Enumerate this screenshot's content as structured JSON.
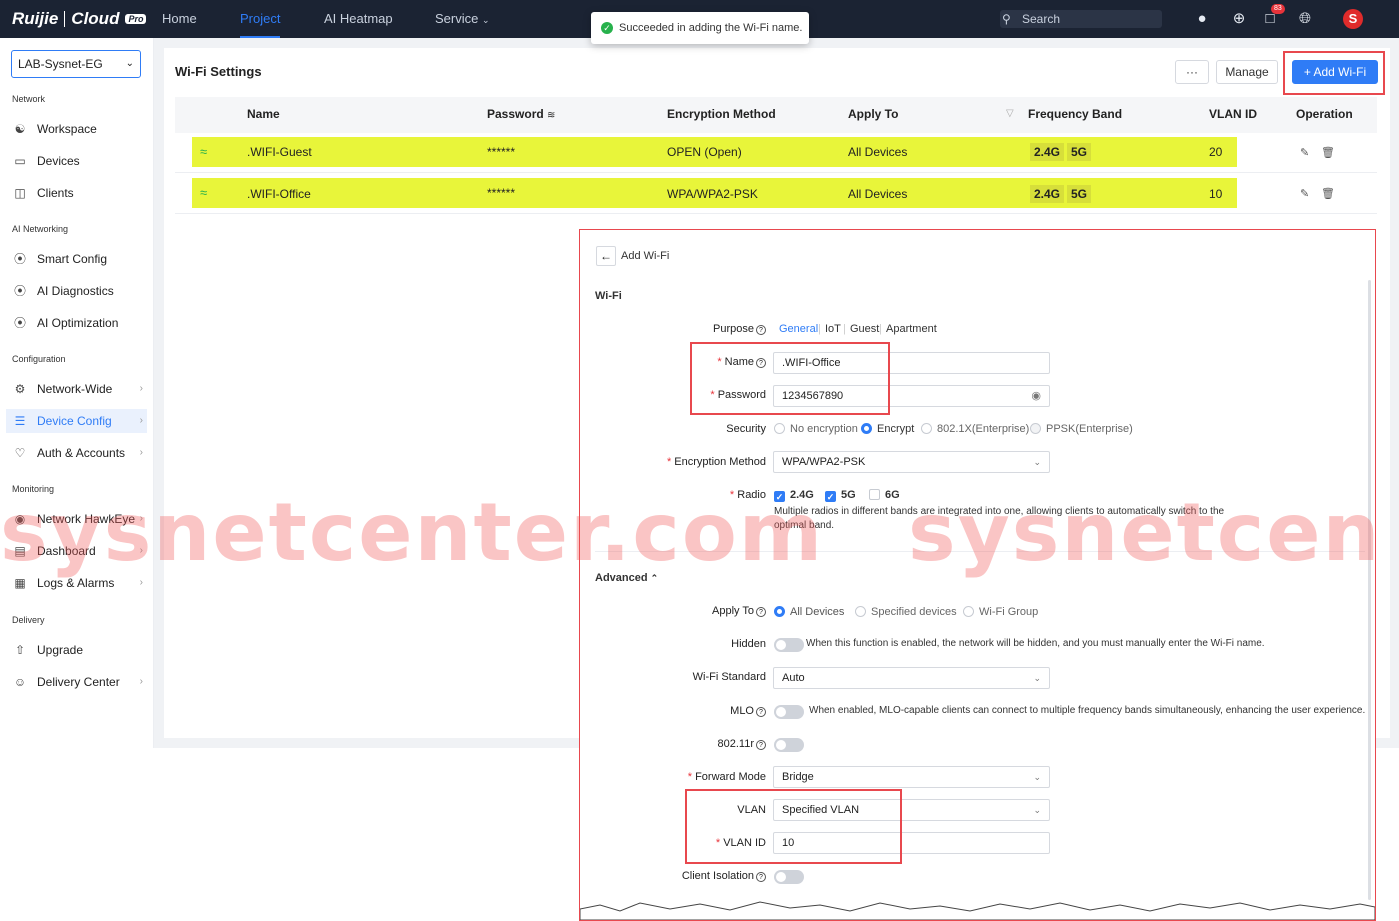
{
  "topbar": {
    "brand": "Ruijie",
    "product": "Cloud",
    "badge": "Pro",
    "nav": [
      "Home",
      "Project",
      "AI Heatmap",
      "Service"
    ],
    "active_nav": "Project",
    "search_placeholder": "Search",
    "notifications": "83",
    "avatar_letter": "S"
  },
  "toast": {
    "text": "Succeeded in adding the Wi-Fi name."
  },
  "sidebar": {
    "project": "LAB-Sysnet-EG",
    "sections": [
      {
        "title": "Network",
        "items": [
          "Workspace",
          "Devices",
          "Clients"
        ]
      },
      {
        "title": "AI Networking",
        "items": [
          "Smart Config",
          "AI Diagnostics",
          "AI Optimization"
        ]
      },
      {
        "title": "Configuration",
        "items": [
          "Network-Wide",
          "Device Config",
          "Auth & Accounts"
        ]
      },
      {
        "title": "Monitoring",
        "items": [
          "Network HawkEye",
          "Dashboard",
          "Logs & Alarms"
        ]
      },
      {
        "title": "Delivery",
        "items": [
          "Upgrade",
          "Delivery Center"
        ]
      }
    ],
    "active_item": "Device Config"
  },
  "main": {
    "title": "Wi-Fi Settings",
    "more_label": "···",
    "manage_label": "Manage",
    "add_label": "+ Add Wi-Fi",
    "columns": [
      "Name",
      "Password",
      "Encryption Method",
      "Apply To",
      "Frequency Band",
      "VLAN ID",
      "Operation"
    ],
    "rows": [
      {
        "name": ".WIFI-Guest",
        "password": "******",
        "encryption": "OPEN (Open)",
        "apply_to": "All Devices",
        "band1": "2.4G",
        "band2": "5G",
        "vlan": "20"
      },
      {
        "name": ".WIFI-Office",
        "password": "******",
        "encryption": "WPA/WPA2-PSK",
        "apply_to": "All Devices",
        "band1": "2.4G",
        "band2": "5G",
        "vlan": "10"
      }
    ]
  },
  "panel": {
    "back_title": "Add Wi-Fi",
    "section_wifi": "Wi-Fi",
    "purpose_label": "Purpose",
    "purpose_options": [
      "General",
      "IoT",
      "Guest",
      "Apartment"
    ],
    "name_label": "Name",
    "name_value": ".WIFI-Office",
    "password_label": "Password",
    "password_value": "1234567890",
    "security_label": "Security",
    "security_options": [
      "No encryption",
      "Encrypt",
      "802.1X(Enterprise)",
      "PPSK(Enterprise)"
    ],
    "encryption_label": "Encryption Method",
    "encryption_value": "WPA/WPA2-PSK",
    "radio_label": "Radio",
    "radio_options": [
      "2.4G",
      "5G",
      "6G"
    ],
    "radio_note": "Multiple radios in different bands are integrated into one, allowing clients to automatically switch to the optimal band.",
    "section_advanced": "Advanced",
    "apply_label": "Apply To",
    "apply_options": [
      "All Devices",
      "Specified devices",
      "Wi-Fi Group"
    ],
    "hidden_label": "Hidden",
    "hidden_note": "When this function is enabled, the network will be hidden, and you must manually enter the Wi-Fi name.",
    "standard_label": "Wi-Fi Standard",
    "standard_value": "Auto",
    "mlo_label": "MLO",
    "mlo_note": "When enabled, MLO-capable clients can connect to multiple frequency bands simultaneously, enhancing the user experience.",
    "r80211_label": "802.11r",
    "forward_label": "Forward Mode",
    "forward_value": "Bridge",
    "vlan_label": "VLAN",
    "vlan_value": "Specified VLAN",
    "vlanid_label": "VLAN ID",
    "vlanid_value": "10",
    "isolation_label": "Client Isolation"
  },
  "watermark": {
    "left": "sysnetcenter.com",
    "right": "sysnetcen"
  },
  "colors": {
    "accent": "#2f7cf6",
    "highlight": "#e8f53a",
    "annotation": "#e8484e",
    "topbar": "#1b2333"
  }
}
